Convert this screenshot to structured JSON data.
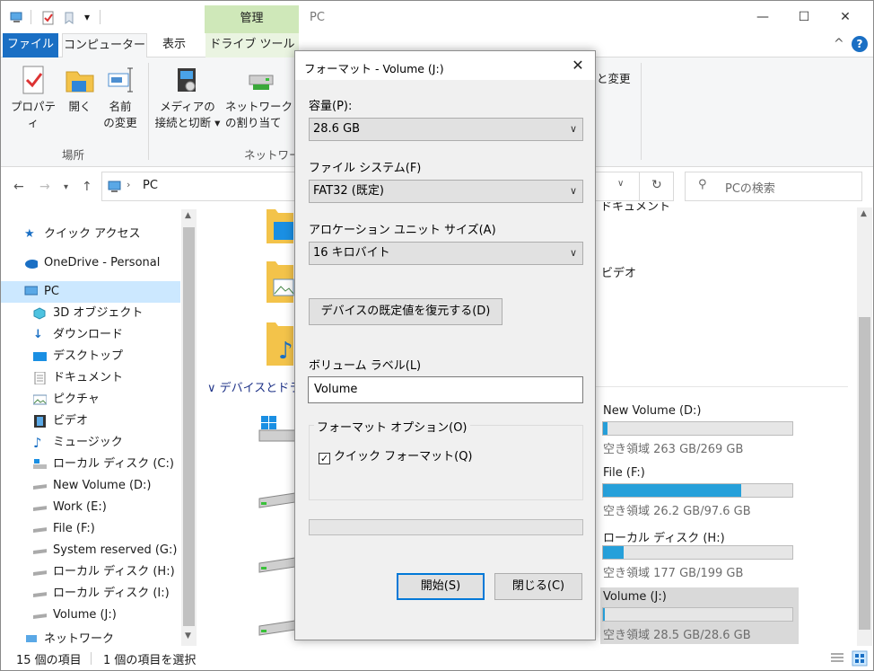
{
  "titlebar": {
    "context_tab": "管理",
    "title": "PC",
    "minimize": "—",
    "maximize": "☐",
    "close": "✕"
  },
  "tabs": {
    "file": "ファイル",
    "computer": "コンピューター",
    "view": "表示",
    "drive_tools": "ドライブ ツール",
    "help_toggle": "^",
    "help": "?"
  },
  "ribbon": {
    "properties": "プロパティ",
    "open": "開く",
    "rename_1": "名前",
    "rename_2": "の変更",
    "media_1": "メディアの",
    "media_2": "接続と切断",
    "network_1": "ネットワーク ドライブ",
    "network_2": "の割り当て",
    "group_location": "場所",
    "group_network": "ネットワーク",
    "change_fragment": "と変更"
  },
  "address": {
    "path": "PC",
    "search_placeholder": "PCの検索"
  },
  "nav": {
    "items": [
      {
        "label": "クイック アクセス"
      },
      {
        "label": "OneDrive - Personal"
      },
      {
        "label": "PC"
      },
      {
        "label": "3D オブジェクト"
      },
      {
        "label": "ダウンロード"
      },
      {
        "label": "デスクトップ"
      },
      {
        "label": "ドキュメント"
      },
      {
        "label": "ピクチャ"
      },
      {
        "label": "ビデオ"
      },
      {
        "label": "ミュージック"
      },
      {
        "label": "ローカル ディスク (C:)"
      },
      {
        "label": "New Volume (D:)"
      },
      {
        "label": "Work (E:)"
      },
      {
        "label": "File (F:)"
      },
      {
        "label": "System reserved (G:)"
      },
      {
        "label": "ローカル ディスク (H:)"
      },
      {
        "label": "ローカル ディスク (I:)"
      },
      {
        "label": "Volume (J:)"
      },
      {
        "label": "ネットワーク"
      }
    ]
  },
  "content": {
    "documents_fragment": "ドキュメント",
    "videos_label": "ビデオ",
    "devices_header": "デバイスとドライブ",
    "drives": [
      {
        "name": "New Volume (D:)",
        "free": "空き領域 263 GB/269 GB",
        "used_fraction": 0.022
      },
      {
        "name": "File (F:)",
        "free": "空き領域 26.2 GB/97.6 GB",
        "used_fraction": 0.73
      },
      {
        "name": "ローカル ディスク (H:)",
        "free": "空き領域 177 GB/199 GB",
        "used_fraction": 0.11
      },
      {
        "name": "Volume (J:)",
        "free": "空き領域 28.5 GB/28.6 GB",
        "used_fraction": 0.003
      }
    ]
  },
  "status": {
    "count": "15 個の項目",
    "selected": "1 個の項目を選択"
  },
  "dialog": {
    "title": "フォーマット - Volume (J:)",
    "capacity_label": "容量(P):",
    "capacity_value": "28.6 GB",
    "fs_label": "ファイル システム(F)",
    "fs_value": "FAT32 (既定)",
    "alloc_label": "アロケーション ユニット サイズ(A)",
    "alloc_value": "16 キロバイト",
    "reset_button": "デバイスの既定値を復元する(D)",
    "volume_label": "ボリューム ラベル(L)",
    "volume_value": "Volume",
    "options_label": "フォーマット オプション(O)",
    "quick_format": "クイック フォーマット(Q)",
    "quick_format_checked": true,
    "start_button": "開始(S)",
    "close_button": "閉じる(C)",
    "close_glyph": "✕"
  },
  "colors": {
    "accent": "#1a6fc4",
    "drive_tools_tab": "#cfe8b9",
    "drive_bar_fill": "#26a0da",
    "selected_row": "#cce8ff"
  }
}
